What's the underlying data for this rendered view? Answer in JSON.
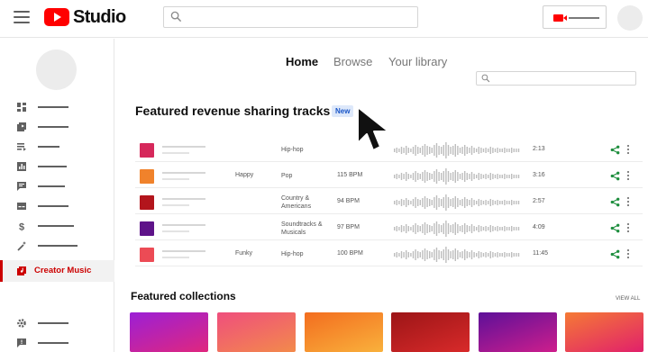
{
  "app": {
    "title": "Studio"
  },
  "sidebar": {
    "items": [
      {
        "icon": "dashboard-icon",
        "active": false
      },
      {
        "icon": "content-icon",
        "active": false
      },
      {
        "icon": "playlists-icon",
        "active": false
      },
      {
        "icon": "analytics-icon",
        "active": false
      },
      {
        "icon": "comments-icon",
        "active": false
      },
      {
        "icon": "subtitles-icon",
        "active": false
      },
      {
        "icon": "monetization-icon",
        "active": false
      },
      {
        "icon": "customization-icon",
        "active": false
      },
      {
        "icon": "creator-music-icon",
        "active": true,
        "label": "Creator Music"
      },
      {
        "icon": "settings-icon",
        "active": false
      },
      {
        "icon": "feedback-icon",
        "active": false
      }
    ]
  },
  "tabs": [
    {
      "label": "Home",
      "active": true
    },
    {
      "label": "Browse",
      "active": false
    },
    {
      "label": "Your library",
      "active": false
    }
  ],
  "featured_tracks": {
    "title": "Featured revenue sharing tracks",
    "badge": "New",
    "tracks": [
      {
        "mood": "",
        "genre": "Hip-hop",
        "bpm": "",
        "duration": "2:13",
        "color": "#d6285b"
      },
      {
        "mood": "Happy",
        "genre": "Pop",
        "bpm": "115 BPM",
        "duration": "3:16",
        "color": "#f0822b"
      },
      {
        "mood": "",
        "genre": "Country & Americans",
        "bpm": "94 BPM",
        "duration": "2:57",
        "color": "#b3151c"
      },
      {
        "mood": "",
        "genre": "Soundtracks & Musicals",
        "bpm": "97 BPM",
        "duration": "4:09",
        "color": "#5e1389"
      },
      {
        "mood": "Funky",
        "genre": "Hip-hop",
        "bpm": "100 BPM",
        "duration": "11:45",
        "color": "#ec4b55"
      }
    ]
  },
  "collections": {
    "title": "Featured collections",
    "view_all": "VIEW ALL",
    "items": [
      {
        "gradient": [
          "#9b1fd6",
          "#e0277e"
        ]
      },
      {
        "gradient": [
          "#ef4e7d",
          "#f38a4b"
        ]
      },
      {
        "gradient": [
          "#f36d1f",
          "#f9b13c"
        ]
      },
      {
        "gradient": [
          "#9c1517",
          "#d82a2a"
        ]
      },
      {
        "gradient": [
          "#5d1099",
          "#ce1e8c"
        ]
      },
      {
        "gradient": [
          "#f57a35",
          "#e1206b"
        ]
      }
    ]
  },
  "colors": {
    "accent": "#ff0000",
    "active": "#cc0000",
    "share": "#1e8e3e",
    "badge_bg": "#dde8fa",
    "badge_text": "#1a56c8"
  }
}
